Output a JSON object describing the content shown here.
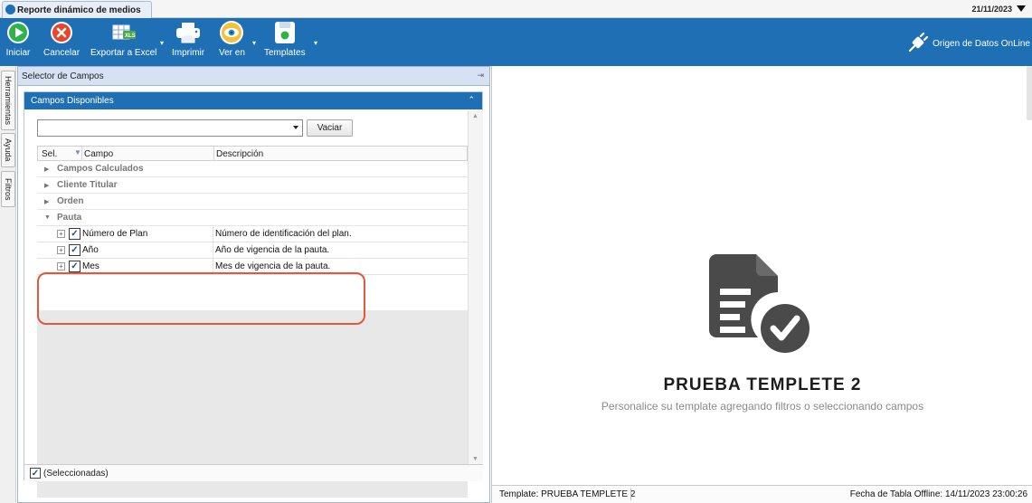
{
  "window": {
    "tab_title": "Reporte dinámico de medios",
    "date": "21/11/2023"
  },
  "toolbar": {
    "iniciar": "Iniciar",
    "cancelar": "Cancelar",
    "exportar": "Exportar a Excel",
    "imprimir": "Imprimir",
    "ver_en": "Ver en",
    "templates": "Templates",
    "datasource": "Origen de Datos OnLine",
    "colors": {
      "bar": "#1f6fb5",
      "iniciar": "#2db34a",
      "cancelar": "#e8452c"
    }
  },
  "side_tabs": [
    "Herramientas",
    "Ayuda",
    "Filtros"
  ],
  "left_panel": {
    "title": "Selector de Campos",
    "group_title": "Campos Disponibles",
    "clear_button": "Vaciar",
    "columns": {
      "sel": "Sel.",
      "campo": "Campo",
      "descripcion": "Descripción"
    },
    "groups": [
      "Campos Calculados",
      "Cliente Titular",
      "Orden",
      "Pauta"
    ],
    "rows": [
      {
        "campo": "Número de Plan",
        "descripcion": "Número de identificación del plan.",
        "checked": true
      },
      {
        "campo": "Año",
        "descripcion": "Año de vigencia de la pauta.",
        "checked": true
      },
      {
        "campo": "Mes",
        "descripcion": "Mes de vigencia de la pauta.",
        "checked": true
      }
    ],
    "footer_label": "(Seleccionadas)"
  },
  "right_panel": {
    "template_title": "PRUEBA TEMPLETE 2",
    "template_subtitle": "Personalice su template agregando filtros o seleccionando campos"
  },
  "status": {
    "template": "Template: PRUEBA TEMPLETE 2",
    "offline": "Fecha de Tabla Offline: 14/11/2023 23:00:26"
  }
}
